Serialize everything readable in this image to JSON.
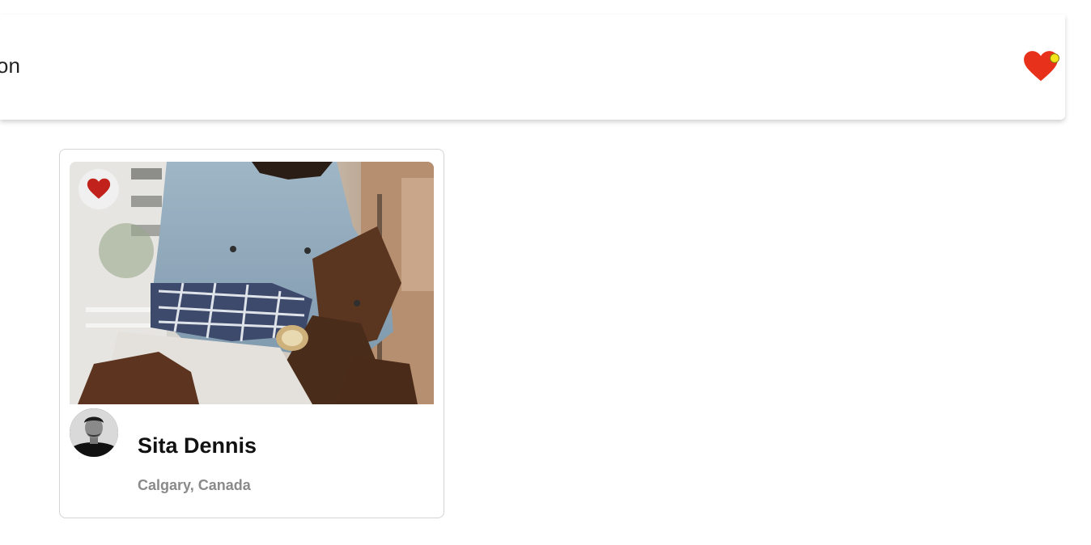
{
  "header": {
    "brand_text": "shion",
    "favorites_icon": "heart-icon",
    "notification_badge_color": "#f5e51b",
    "heart_color": "#e8311a"
  },
  "card": {
    "photo_alt": "photo",
    "like_icon": "heart-icon",
    "like_color": "#c2221c",
    "name": "Sita Dennis",
    "location": "Calgary, Canada"
  }
}
